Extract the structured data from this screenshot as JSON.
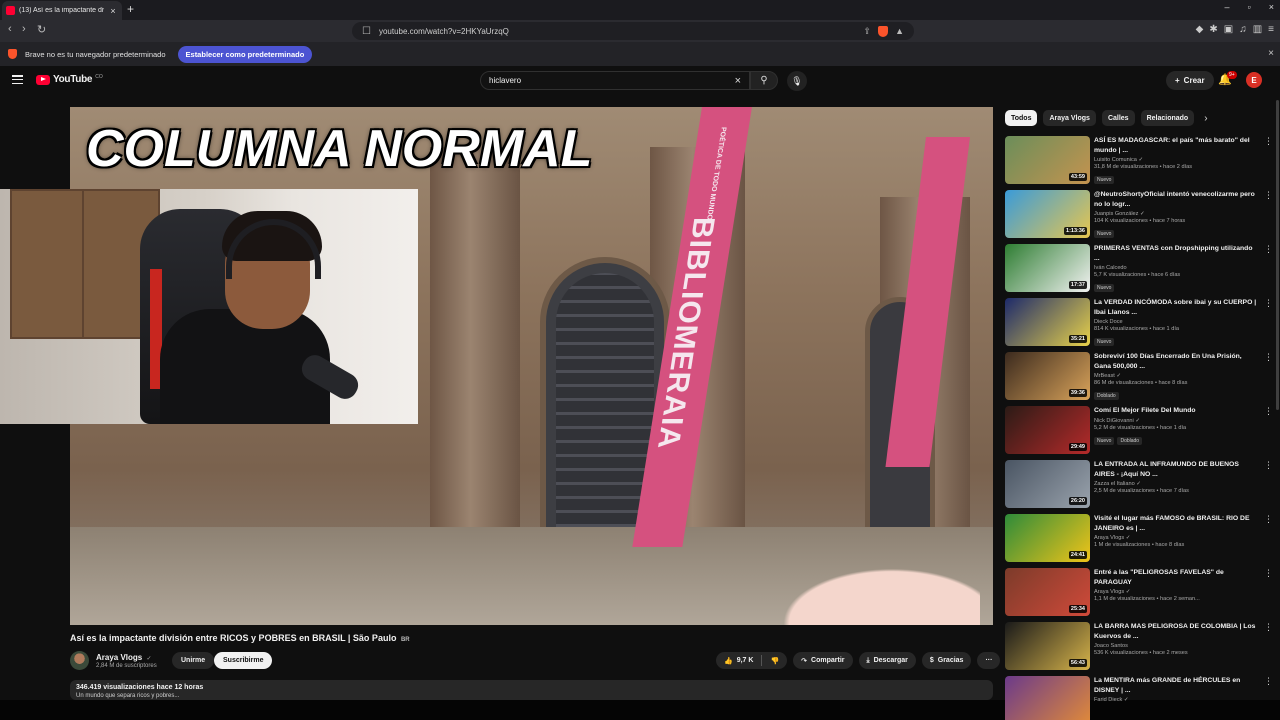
{
  "browser": {
    "tab_title": "(13) Así es la impactante divisi",
    "tab_close": "×",
    "new_tab": "+",
    "window_controls": [
      "–",
      "▫",
      "×"
    ],
    "url": "youtube.com/watch?v=2HKYaUrzqQ",
    "infobar_message": "Brave no es tu navegador predeterminado",
    "infobar_button": "Establecer como predeterminado",
    "infobar_close": "×"
  },
  "youtube": {
    "logo_text": "YouTube",
    "logo_country": "CO",
    "search_query": "hiclavero",
    "create_label": "Crear",
    "notif_count": "9+",
    "avatar_letter": "E"
  },
  "video": {
    "overlay_title": "COLUMNA NORMAL",
    "banner_text": "BIBLIOMERAIA",
    "banner_subtext": "POÉTICA DE TODO MUNDO"
  },
  "watch": {
    "title": "Así es la impactante división entre RICOS y POBRES en BRASIL | São Paulo",
    "title_flag": "BR",
    "channel_name": "Araya Vlogs",
    "channel_subs": "2,84 M de suscriptores",
    "join_label": "Unirme",
    "subscribe_label": "Suscribirme",
    "likes": "9,7 K",
    "share_label": "Compartir",
    "download_label": "Descargar",
    "thanks_label": "Gracias",
    "more_label": "···",
    "description_meta": "346.419 visualizaciones  hace 12 horas",
    "description_preview": "Un mundo que separa ricos y pobres..."
  },
  "chips": [
    "Todos",
    "Araya Vlogs",
    "Calles",
    "Relacionado"
  ],
  "recommendations": [
    {
      "title": "ASÍ ES MADAGASCAR: el país \"más barato\" del mundo | ...",
      "channel": "Luisito Comunica ✓",
      "meta": "31,8 M de visualizaciones • hace 2 días",
      "tags": [
        "Nuevo"
      ],
      "duration": "43:59",
      "c1": "#6b8e5a",
      "c2": "#c4934f"
    },
    {
      "title": "@NeutroShortyOficial intentó venecolizarme pero no lo logr...",
      "channel": "Juanpis González ✓",
      "meta": "104 K visualizaciones • hace 7 horas",
      "tags": [
        "Nuevo"
      ],
      "duration": "1:13:36",
      "c1": "#3a9bd9",
      "c2": "#e7c64f"
    },
    {
      "title": "PRIMERAS VENTAS con Dropshipping utilizando ...",
      "channel": "Iván Calcedo",
      "meta": "5,7 K visualizaciones • hace 6 días",
      "tags": [
        "Nuevo"
      ],
      "duration": "17:37",
      "c1": "#2e7d32",
      "c2": "#f2f2f2"
    },
    {
      "title": "La VERDAD INCÓMODA sobre ibai y su CUERPO | Ibai Llanos ...",
      "channel": "Dieck Doce",
      "meta": "814 K visualizaciones • hace 1 día",
      "tags": [
        "Nuevo"
      ],
      "duration": "35:21",
      "c1": "#1d2a6b",
      "c2": "#e8d24a"
    },
    {
      "title": "Sobreviví 100 Días Encerrado En Una Prisión, Gana 500,000 ...",
      "channel": "MrBeast ✓",
      "meta": "86 M de visualizaciones • hace 8 días",
      "tags": [
        "Doblado"
      ],
      "duration": "39:36",
      "c1": "#3b2a1e",
      "c2": "#d9a35a"
    },
    {
      "title": "Comí El Mejor Filete Del Mundo",
      "channel": "Nick DiGiovanni ✓",
      "meta": "5,2 M de visualizaciones • hace 1 día",
      "tags": [
        "Nuevo",
        "Doblado"
      ],
      "duration": "29:49",
      "c1": "#2b1b16",
      "c2": "#b52a2a"
    },
    {
      "title": "LA ENTRADA AL INFRAMUNDO DE BUENOS AIRES - ¡Aquí NO ...",
      "channel": "Zazza el Italiano ✓",
      "meta": "2,5 M de visualizaciones • hace 7 días",
      "tags": [],
      "duration": "26:20",
      "c1": "#4a5563",
      "c2": "#9aa3ad"
    },
    {
      "title": "Visité el lugar más FAMOSO de BRASIL: RIO DE JANEIRO es | ...",
      "channel": "Araya Vlogs ✓",
      "meta": "1 M de visualizaciones • hace 8 días",
      "tags": [],
      "duration": "24:41",
      "c1": "#2e8b3a",
      "c2": "#f0c419"
    },
    {
      "title": "Entré a las \"PELIGROSAS FAVELAS\" de PARAGUAY",
      "channel": "Araya Vlogs ✓",
      "meta": "1,1 M de visualizaciones • hace 2 seman...",
      "tags": [],
      "duration": "25:34",
      "c1": "#7c3b2a",
      "c2": "#d04a3a"
    },
    {
      "title": "LA BARRA MAS PELIGROSA DE COLOMBIA | Los Kuervos de ...",
      "channel": "Joaco Santos",
      "meta": "536 K visualizaciones • hace 2 meses",
      "tags": [],
      "duration": "56:43",
      "c1": "#1a1a1a",
      "c2": "#d6b34a"
    },
    {
      "title": "La MENTIRA más GRANDE de HÉRCULES en DISNEY | ...",
      "channel": "Farid Dieck ✓",
      "meta": "",
      "tags": [],
      "duration": "",
      "c1": "#6b3a8a",
      "c2": "#e08a3a"
    }
  ]
}
